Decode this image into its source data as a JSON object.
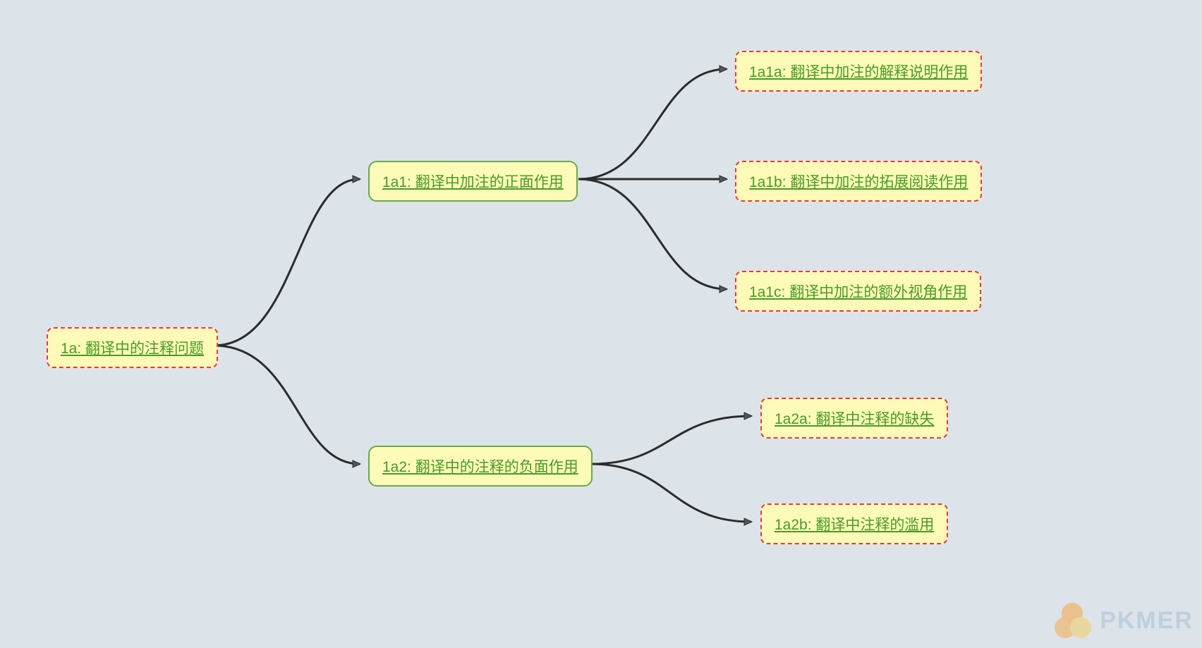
{
  "nodes": {
    "root": {
      "id": "1a",
      "label": "1a: 翻译中的注释问题"
    },
    "n1a1": {
      "id": "1a1",
      "label": "1a1: 翻译中加注的正面作用"
    },
    "n1a2": {
      "id": "1a2",
      "label": "1a2: 翻译中的注释的负面作用"
    },
    "n1a1a": {
      "id": "1a1a",
      "label": "1a1a: 翻译中加注的解释说明作用"
    },
    "n1a1b": {
      "id": "1a1b",
      "label": "1a1b: 翻译中加注的拓展阅读作用"
    },
    "n1a1c": {
      "id": "1a1c",
      "label": "1a1c: 翻译中加注的额外视角作用"
    },
    "n1a2a": {
      "id": "1a2a",
      "label": "1a2a: 翻译中注释的缺失"
    },
    "n1a2b": {
      "id": "1a2b",
      "label": "1a2b: 翻译中注释的滥用"
    }
  },
  "colors": {
    "bg": "#dce3e9",
    "node_fill": "#fdfbb7",
    "node_dashed_border": "#e63946",
    "node_solid_border": "#6aa84f",
    "link_text": "#4a9a2a",
    "edge": "#2b2b2b"
  },
  "watermark": {
    "text": "PKMER"
  }
}
